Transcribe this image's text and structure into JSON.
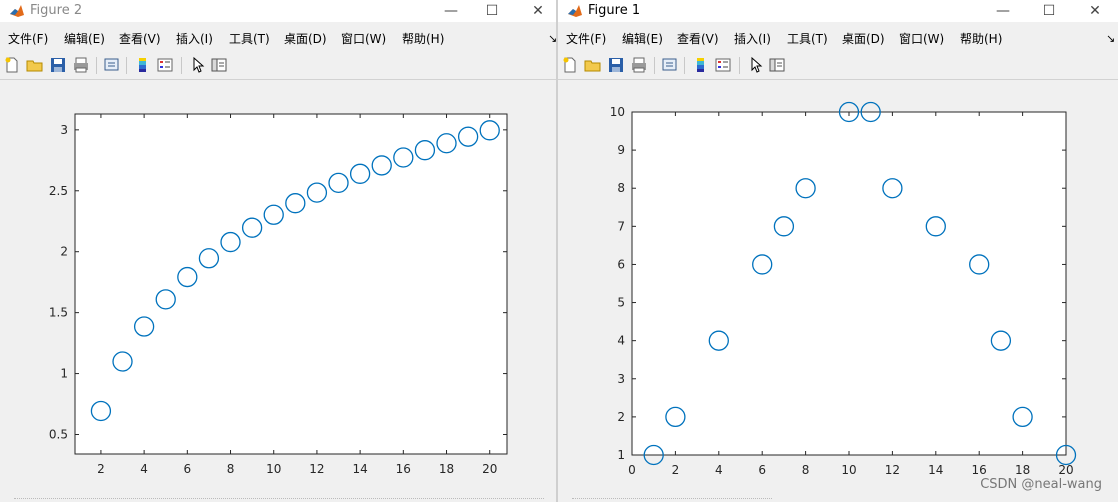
{
  "windows": [
    {
      "id": "win2",
      "title": "Figure 2",
      "controls": {
        "minimize": "—",
        "maximize": "☐",
        "close": "✕"
      },
      "menus": [
        "文件(F)",
        "编辑(E)",
        "查看(V)",
        "插入(I)",
        "工具(T)",
        "桌面(D)",
        "窗口(W)",
        "帮助(H)"
      ],
      "menu_overflow": "↘",
      "toolbar_icons": [
        "new-figure-icon",
        "open-icon",
        "save-icon",
        "print-icon",
        "link-icon",
        "colorbar-icon",
        "legend-icon",
        "pointer-icon",
        "property-editor-icon"
      ]
    },
    {
      "id": "win1",
      "title": "Figure 1",
      "controls": {
        "minimize": "—",
        "maximize": "☐",
        "close": "✕"
      },
      "menus": [
        "文件(F)",
        "编辑(E)",
        "查看(V)",
        "插入(I)",
        "工具(T)",
        "桌面(D)",
        "窗口(W)",
        "帮助(H)"
      ],
      "menu_overflow": "↘",
      "toolbar_icons": [
        "new-figure-icon",
        "open-icon",
        "save-icon",
        "print-icon",
        "link-icon",
        "colorbar-icon",
        "legend-icon",
        "pointer-icon",
        "property-editor-icon"
      ]
    }
  ],
  "chart_data": [
    {
      "type": "scatter",
      "window": "Figure 2",
      "marker": "circle-open",
      "color": "#0072bd",
      "x": [
        2,
        3,
        4,
        5,
        6,
        7,
        8,
        9,
        10,
        11,
        12,
        13,
        14,
        15,
        16,
        17,
        18,
        19,
        20
      ],
      "y": [
        0.693,
        1.099,
        1.386,
        1.609,
        1.792,
        1.946,
        2.079,
        2.197,
        2.303,
        2.398,
        2.485,
        2.565,
        2.639,
        2.708,
        2.773,
        2.833,
        2.89,
        2.944,
        2.996
      ],
      "xlim": [
        0.8,
        20.8
      ],
      "ylim": [
        0.34,
        3.13
      ],
      "xticks": [
        2,
        4,
        6,
        8,
        10,
        12,
        14,
        16,
        18,
        20
      ],
      "yticks": [
        0.5,
        1,
        1.5,
        2,
        2.5,
        3
      ],
      "ytick_labels": [
        "0.5",
        "1",
        "1.5",
        "2",
        "2.5",
        "3"
      ],
      "title": "",
      "xlabel": "",
      "ylabel": "",
      "grid": false
    },
    {
      "type": "scatter",
      "window": "Figure 1",
      "marker": "circle-open",
      "color": "#0072bd",
      "x": [
        1,
        2,
        4,
        6,
        7,
        8,
        10,
        11,
        12,
        14,
        16,
        17,
        18,
        20
      ],
      "y": [
        1,
        2,
        4,
        6,
        7,
        8,
        10,
        10,
        8,
        7,
        6,
        4,
        2,
        1
      ],
      "xlim": [
        0,
        20
      ],
      "ylim": [
        1,
        10
      ],
      "xticks": [
        0,
        2,
        4,
        6,
        8,
        10,
        12,
        14,
        16,
        18,
        20
      ],
      "yticks": [
        1,
        2,
        3,
        4,
        5,
        6,
        7,
        8,
        9,
        10
      ],
      "ytick_labels": [
        "1",
        "2",
        "3",
        "4",
        "5",
        "6",
        "7",
        "8",
        "9",
        "10"
      ],
      "title": "",
      "xlabel": "",
      "ylabel": "",
      "grid": false
    }
  ],
  "watermark": "CSDN @neal-wang"
}
